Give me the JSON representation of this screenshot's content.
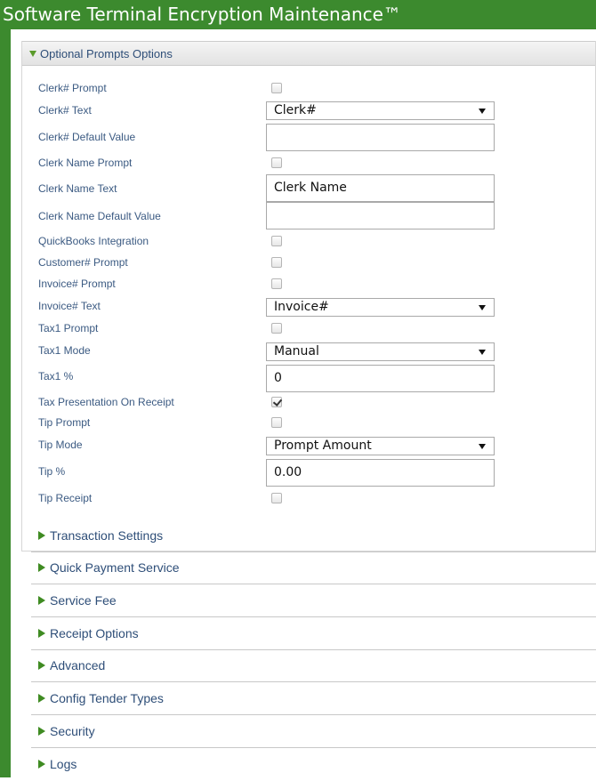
{
  "app": {
    "title": "Software Terminal Encryption Maintenance™"
  },
  "panel": {
    "title": "Optional Prompts Options"
  },
  "fields": {
    "clerk_prompt": {
      "label": "Clerk# Prompt",
      "checked": false
    },
    "clerk_text": {
      "label": "Clerk# Text",
      "value": "Clerk#"
    },
    "clerk_default": {
      "label": "Clerk# Default Value",
      "value": ""
    },
    "clerk_name_prompt": {
      "label": "Clerk Name Prompt",
      "checked": false
    },
    "clerk_name_text": {
      "label": "Clerk Name Text",
      "value": "Clerk Name"
    },
    "clerk_name_default": {
      "label": "Clerk Name Default Value",
      "value": ""
    },
    "quickbooks": {
      "label": "QuickBooks Integration",
      "checked": false
    },
    "customer_prompt": {
      "label": "Customer# Prompt",
      "checked": false
    },
    "invoice_prompt": {
      "label": "Invoice# Prompt",
      "checked": false
    },
    "invoice_text": {
      "label": "Invoice# Text",
      "value": "Invoice#"
    },
    "tax1_prompt": {
      "label": "Tax1 Prompt",
      "checked": false
    },
    "tax1_mode": {
      "label": "Tax1 Mode",
      "value": "Manual"
    },
    "tax1_pct": {
      "label": "Tax1 %",
      "value": "0"
    },
    "tax_presentation": {
      "label": "Tax Presentation On Receipt",
      "checked": true
    },
    "tip_prompt": {
      "label": "Tip Prompt",
      "checked": false
    },
    "tip_mode": {
      "label": "Tip Mode",
      "value": "Prompt Amount"
    },
    "tip_pct": {
      "label": "Tip %",
      "value": "0.00"
    },
    "tip_receipt": {
      "label": "Tip Receipt",
      "checked": false
    }
  },
  "sections": [
    "Transaction Settings",
    "Quick Payment Service",
    "Service Fee",
    "Receipt Options",
    "Advanced",
    "Config Tender Types",
    "Security",
    "Logs"
  ],
  "colors": {
    "brand": "#3c8a2e",
    "label": "#3b5a82",
    "expander": "#3f8b22"
  }
}
